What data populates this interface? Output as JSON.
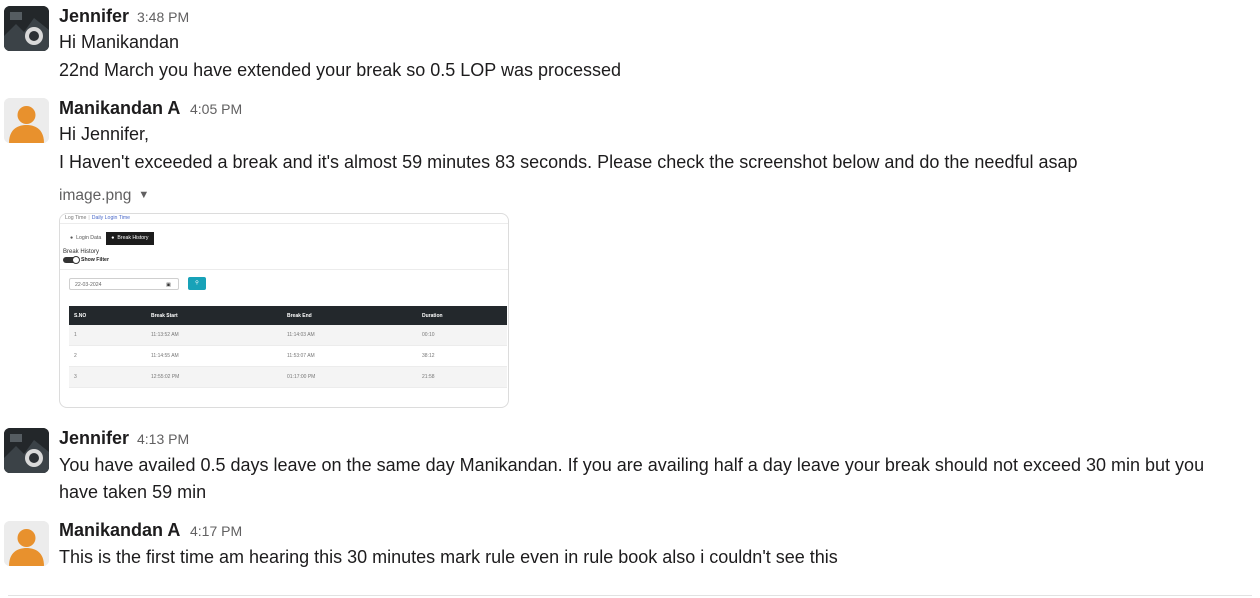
{
  "messages": [
    {
      "author": "Jennifer",
      "time": "3:48 PM",
      "lines": [
        "Hi Manikandan",
        "22nd March you have extended your break so 0.5 LOP was processed"
      ]
    },
    {
      "author": "Manikandan A",
      "time": "4:05 PM",
      "lines": [
        "Hi Jennifer,",
        "I Haven't exceeded a break and it's almost 59 minutes 83 seconds. Please check the screenshot below and do the needful asap"
      ],
      "attachment": {
        "filename": "image.png",
        "screenshot": {
          "breadcrumb": [
            "Log Time",
            "Daily Login Time"
          ],
          "tabs": [
            "Login Data",
            "Break History"
          ],
          "section_title": "Break History",
          "toggle_label": "Show Filter",
          "date_value": "22-03-2024",
          "columns": [
            "S.NO",
            "Break Start",
            "Break End",
            "Duration"
          ],
          "rows": [
            [
              "1",
              "11:13:52 AM",
              "11:14:03 AM",
              "00:10"
            ],
            [
              "2",
              "11:14:55 AM",
              "11:53:07 AM",
              "38:12"
            ],
            [
              "3",
              "12:55:02 PM",
              "01:17:00 PM",
              "21:58"
            ]
          ]
        }
      }
    },
    {
      "author": "Jennifer",
      "time": "4:13 PM",
      "lines": [
        "You have availed 0.5 days leave on the same day Manikandan. If you are availing half a day leave your break should not exceed 30 min but you",
        "have taken 59 min"
      ]
    },
    {
      "author": "Manikandan A",
      "time": "4:17 PM",
      "lines": [
        "This is the first time am hearing this 30 minutes mark rule even in rule book also i couldn't see this"
      ]
    }
  ]
}
